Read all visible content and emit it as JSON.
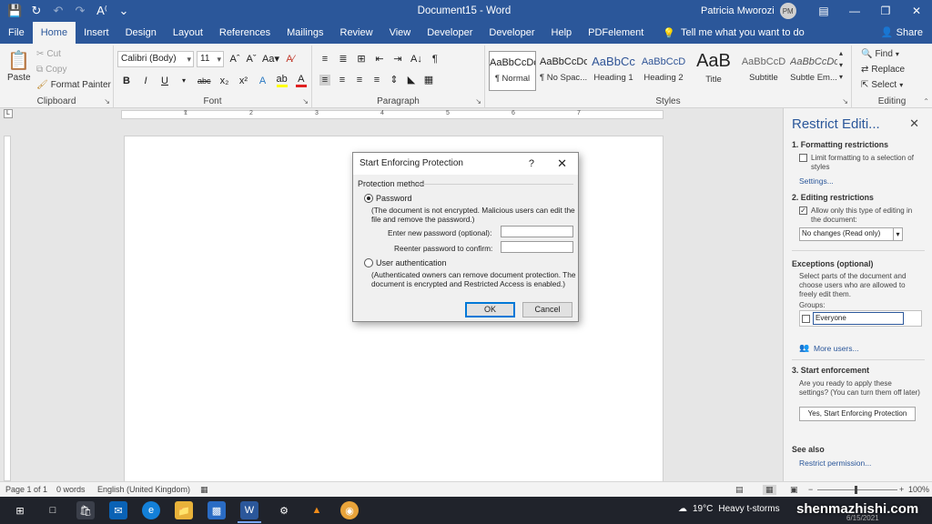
{
  "titlebar": {
    "document_title": "Document15 - Word",
    "user_name": "Patricia Mworozi",
    "user_initials": "PM"
  },
  "tabs": [
    "File",
    "Home",
    "Insert",
    "Design",
    "Layout",
    "References",
    "Mailings",
    "Review",
    "View",
    "Developer",
    "Developer",
    "Help",
    "PDFelement"
  ],
  "active_tab": "Home",
  "tell_me": "Tell me what you want to do",
  "share": "Share",
  "ribbon": {
    "clipboard": {
      "paste": "Paste",
      "cut": "Cut",
      "copy": "Copy",
      "format_painter": "Format Painter",
      "label": "Clipboard"
    },
    "font": {
      "font_name": "Calibri (Body)",
      "font_size": "11",
      "label": "Font"
    },
    "paragraph": {
      "label": "Paragraph"
    },
    "styles": {
      "label": "Styles",
      "items": [
        {
          "sample": "AaBbCcDc",
          "name": "¶ Normal"
        },
        {
          "sample": "AaBbCcDc",
          "name": "¶ No Spac..."
        },
        {
          "sample": "AaBbCc",
          "name": "Heading 1"
        },
        {
          "sample": "AaBbCcD",
          "name": "Heading 2"
        },
        {
          "sample": "AaB",
          "name": "Title"
        },
        {
          "sample": "AaBbCcD",
          "name": "Subtitle"
        },
        {
          "sample": "AaBbCcDc",
          "name": "Subtle Em..."
        }
      ]
    },
    "editing": {
      "find": "Find",
      "replace": "Replace",
      "select": "Select",
      "label": "Editing"
    }
  },
  "ruler_numbers": [
    "1",
    "2",
    "3",
    "4",
    "5",
    "6",
    "7"
  ],
  "dialog": {
    "title": "Start Enforcing Protection",
    "help": "?",
    "group_label": "Protection method",
    "password_option": "Password",
    "password_note": "(The document is not encrypted. Malicious users can edit the file and remove the password.)",
    "new_password_label": "Enter new password (optional):",
    "reenter_label": "Reenter password to confirm:",
    "user_auth_option": "User authentication",
    "user_auth_note": "(Authenticated owners can remove document protection. The document is encrypted and Restricted Access is enabled.)",
    "ok": "OK",
    "cancel": "Cancel"
  },
  "pane": {
    "title": "Restrict Editi...",
    "s1_head": "1. Formatting restrictions",
    "s1_check": "Limit formatting to a selection of styles",
    "s1_link": "Settings...",
    "s2_head": "2. Editing restrictions",
    "s2_check": "Allow only this type of editing in the document:",
    "s2_select": "No changes (Read only)",
    "exceptions_head": "Exceptions (optional)",
    "exceptions_text": "Select parts of the document and choose users who are allowed to freely edit them.",
    "groups_label": "Groups:",
    "group_everyone": "Everyone",
    "more_users": "More users...",
    "s3_head": "3. Start enforcement",
    "s3_text": "Are you ready to apply these settings? (You can turn them off later)",
    "s3_button": "Yes, Start Enforcing Protection",
    "see_also": "See also",
    "restrict_permission": "Restrict permission..."
  },
  "status": {
    "page": "Page 1 of 1",
    "words": "0 words",
    "language": "English (United Kingdom)",
    "zoom": "100%"
  },
  "taskbar": {
    "temperature": "19°C",
    "weather": "Heavy t-storms",
    "watermark": "shenmazhishi.com",
    "date": "6/15/2021"
  },
  "colors": {
    "word_blue": "#2b579a",
    "ribbon_bg": "#f3f3f3",
    "taskbar": "#20232b"
  }
}
